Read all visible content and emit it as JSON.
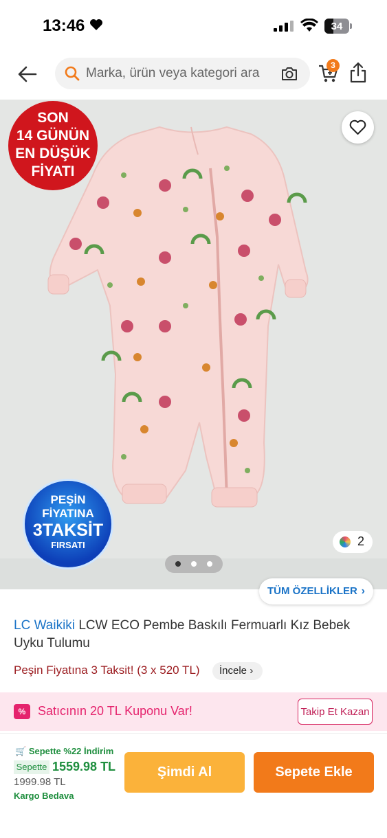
{
  "status_bar": {
    "time": "13:46",
    "battery": "34"
  },
  "header": {
    "search_placeholder": "Marka, ürün veya kategori ara",
    "cart_count": "3"
  },
  "gallery": {
    "promo_badge_lines": [
      "SON",
      "14 GÜNÜN",
      "EN DÜŞÜK",
      "FİYATI"
    ],
    "installment_badge": {
      "line1": "PEŞİN",
      "line2": "FİYATINA",
      "line3": "3TAKSİT",
      "line4": "FIRSATI"
    },
    "color_count": "2"
  },
  "features_button": "TÜM ÖZELLİKLER",
  "product": {
    "brand": "LC Waikiki",
    "name": "LCW ECO Pembe Baskılı Fermuarlı Kız Bebek Uyku Tulumu"
  },
  "installment": {
    "text": "Peşin Fiyatına 3 Taksit! (3 x 520 TL)",
    "review_label": "İncele"
  },
  "coupon": {
    "text": "Satıcının 20 TL Kuponu Var!",
    "follow_label": "Takip Et Kazan"
  },
  "pricing": {
    "discount_label": "Sepette %22 İndirim",
    "cart_tag": "Sepette",
    "cart_price": "1559.98 TL",
    "original_price": "1999.98 TL",
    "shipping": "Kargo Bedava"
  },
  "actions": {
    "buy_now": "Şimdi Al",
    "add_to_cart": "Sepete Ekle"
  },
  "colors": {
    "accent": "#f27a1a",
    "link": "#1a73c7",
    "coupon": "#e5236d",
    "green": "#1e8e3e",
    "promo_red": "#d0161d"
  }
}
